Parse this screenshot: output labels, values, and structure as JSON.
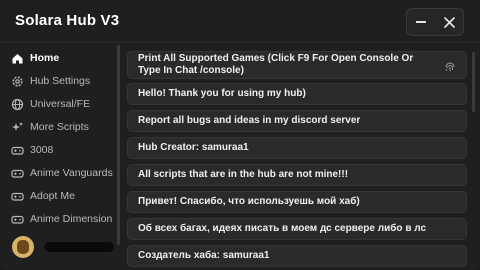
{
  "window": {
    "title": "Solara Hub V3"
  },
  "sidebar": {
    "items": [
      {
        "label": "Home",
        "icon": "home-icon",
        "active": true
      },
      {
        "label": "Hub Settings",
        "icon": "gear-icon"
      },
      {
        "label": "Universal/FE",
        "icon": "globe-icon"
      },
      {
        "label": "More Scripts",
        "icon": "sparkles-icon"
      },
      {
        "label": "3008",
        "icon": "gamepad-icon"
      },
      {
        "label": "Anime Vanguards",
        "icon": "gamepad-icon"
      },
      {
        "label": "Adopt Me",
        "icon": "gamepad-icon"
      },
      {
        "label": "Anime Dimension",
        "icon": "gamepad-icon"
      }
    ]
  },
  "main": {
    "rows": [
      {
        "text": "Print All Supported Games (Click F9 For Open Console Or Type In Chat /console)",
        "icon": "fingerprint-icon"
      },
      {
        "text": "Hello! Thank you for using my hub)"
      },
      {
        "text": "Report all bugs and ideas in my discord server"
      },
      {
        "text": "Hub Creator: samuraa1"
      },
      {
        "text": "All scripts that are in the hub are not mine!!!"
      },
      {
        "text": "Привет! Спасибо, что используешь мой хаб)"
      },
      {
        "text": "Об всех багах, идеях писать в моем дс сервере либо в лс"
      },
      {
        "text": "Создатель хаба: samuraa1"
      }
    ]
  },
  "colors": {
    "background": "#1f1f1f",
    "row": "#2a2a2a",
    "text": "#f0f0f0",
    "muted": "#b9b9b9"
  }
}
